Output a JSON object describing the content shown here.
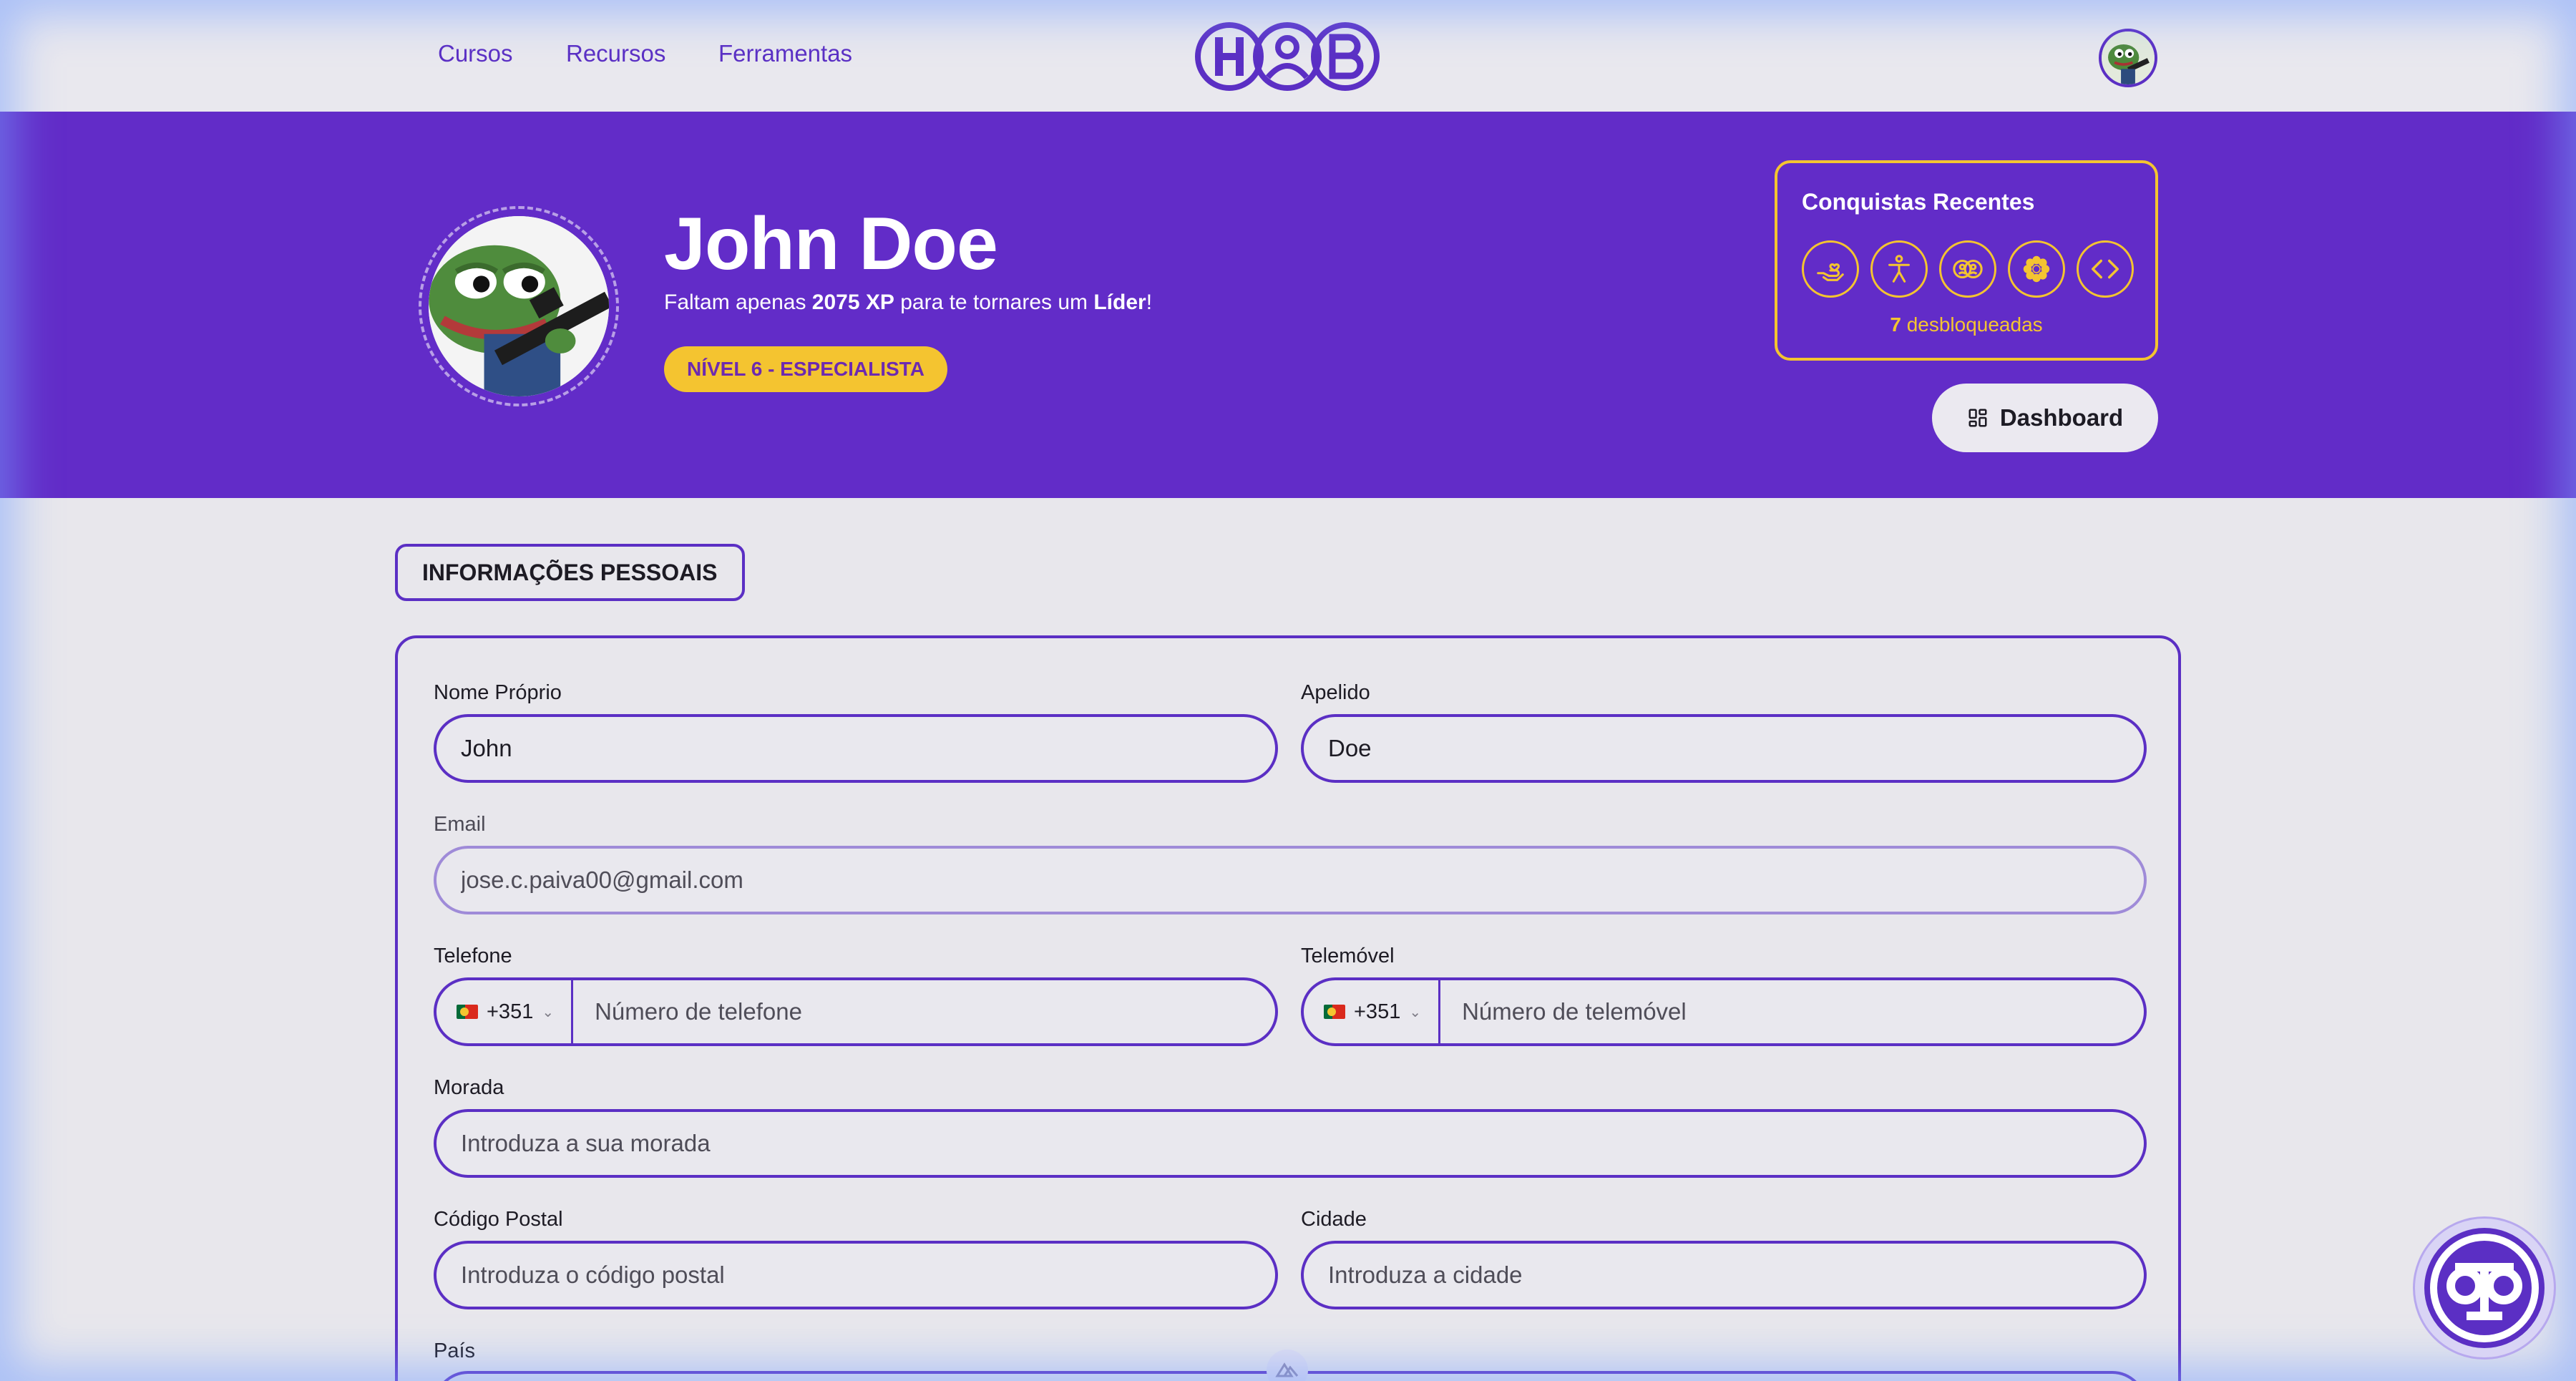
{
  "nav": {
    "links": [
      "Cursos",
      "Recursos",
      "Ferramentas"
    ],
    "logo_text": "HOB"
  },
  "profile": {
    "name": "John Doe",
    "xp_prefix": "Faltam apenas ",
    "xp_value": "2075 XP",
    "xp_middle": " para te tornares um ",
    "next_rank": "Líder",
    "xp_suffix": "!",
    "level_badge": "NÍVEL 6 - ESPECIALISTA"
  },
  "achievements": {
    "title": "Conquistas Recentes",
    "icons": [
      "hand-heart-icon",
      "person-icon",
      "people-icon",
      "flower-icon",
      "code-icon"
    ],
    "count": "7",
    "count_label": " desbloqueadas"
  },
  "dashboard_button": {
    "label": "Dashboard",
    "icon": "grid-icon"
  },
  "section": {
    "title": "INFORMAÇÕES PESSOAIS"
  },
  "form": {
    "first_name": {
      "label": "Nome Próprio",
      "value": "John"
    },
    "last_name": {
      "label": "Apelido",
      "value": "Doe"
    },
    "email": {
      "label": "Email",
      "placeholder": "jose.c.paiva00@gmail.com"
    },
    "phone": {
      "label": "Telefone",
      "country_code": "+351",
      "placeholder": "Número de telefone"
    },
    "mobile": {
      "label": "Telemóvel",
      "country_code": "+351",
      "placeholder": "Número de telemóvel"
    },
    "address": {
      "label": "Morada",
      "placeholder": "Introduza a sua morada"
    },
    "postal_code": {
      "label": "Código Postal",
      "placeholder": "Introduza o código postal"
    },
    "city": {
      "label": "Cidade",
      "placeholder": "Introduza a cidade"
    },
    "country": {
      "label": "País"
    }
  },
  "colors": {
    "primary": "#622cc8",
    "accent": "#f4c430",
    "background": "#e8e7ec"
  }
}
